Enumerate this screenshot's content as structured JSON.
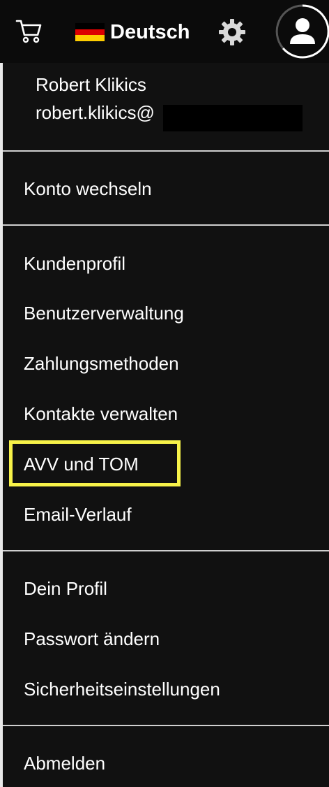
{
  "topbar": {
    "cart_icon": "cart-icon",
    "language": {
      "label": "Deutsch",
      "flag_colors": [
        "#000000",
        "#dd0000",
        "#ffce00"
      ]
    },
    "settings_icon": "gear-icon",
    "avatar_icon": "user-avatar-icon"
  },
  "user": {
    "name": "Robert Klikics",
    "email_visible": "robert.klikics@"
  },
  "menu": {
    "switch_account": "Konto wechseln",
    "account_section": [
      "Kundenprofil",
      "Benutzerverwaltung",
      "Zahlungsmethoden",
      "Kontakte verwalten",
      "AVV und TOM",
      "Email-Verlauf"
    ],
    "profile_section": [
      "Dein Profil",
      "Passwort ändern",
      "Sicherheitseinstellungen"
    ],
    "logout": "Abmelden"
  },
  "colors": {
    "background": "#111111",
    "text": "#ffffff",
    "divider": "#cfcfcf",
    "highlight": "#f7f249"
  }
}
